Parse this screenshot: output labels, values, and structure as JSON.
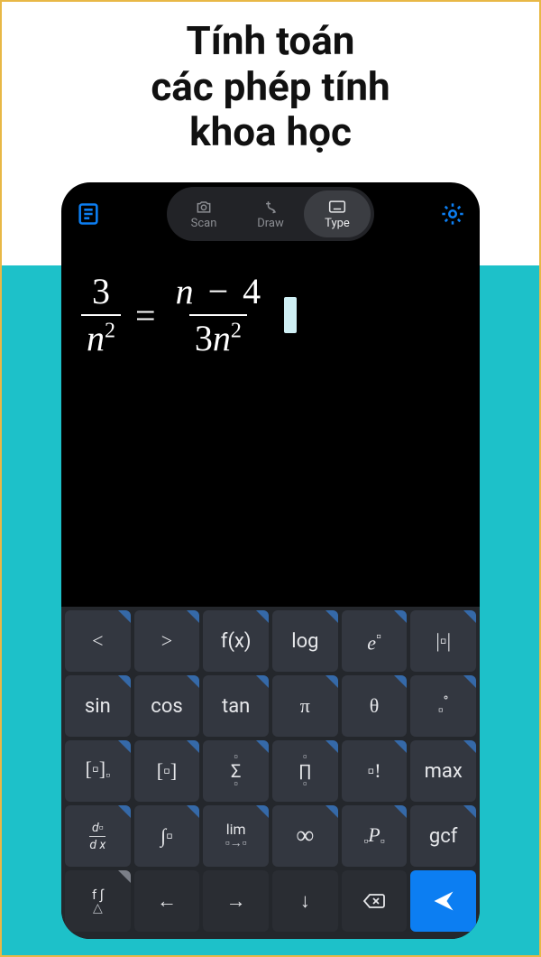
{
  "title_line1": "Tính toán",
  "title_line2": "các phép tính",
  "title_line3": "khoa học",
  "tabs": {
    "scan": "Scan",
    "draw": "Draw",
    "type": "Type"
  },
  "equation": {
    "left_num": "3",
    "left_den_var": "n",
    "left_den_exp": "2",
    "op": "=",
    "right_num_var": "n",
    "right_num_minus": "−",
    "right_num_const": "4",
    "right_den_coeff": "3",
    "right_den_var": "n",
    "right_den_exp": "2"
  },
  "keys": {
    "r1": {
      "lt": "<",
      "gt": ">",
      "fx": "f(x)",
      "log": "log",
      "epow": "e",
      "epow_sup": "▫",
      "abs": "|▫|"
    },
    "r2": {
      "sin": "sin",
      "cos": "cos",
      "tan": "tan",
      "pi": "π",
      "theta": "θ",
      "deg": "▫",
      "deg_sup": "°"
    },
    "r3": {
      "bracket_sub": "[▫]",
      "matrix": "[▫]",
      "sum_top": "▫",
      "sum_mid": "Σ",
      "sum_bot": "▫",
      "prod_top": "▫",
      "prod_mid": "∏",
      "prod_bot": "▫",
      "exclaim": "▫!",
      "max": "max"
    },
    "r4": {
      "ddx_top": "d▫",
      "ddx_bot": "d x",
      "integral": "∫▫",
      "lim": "lim",
      "lim_sub": "▫→▫",
      "inf": "∞",
      "perm_pre": "▫",
      "perm": "P",
      "perm_post": "▫",
      "gcf": "gcf"
    },
    "r5": {
      "shift": "f ∫",
      "shift_sub": "△",
      "left": "←",
      "right": "→",
      "down": "↓",
      "backspace": "⌫",
      "submit": "➤"
    }
  }
}
